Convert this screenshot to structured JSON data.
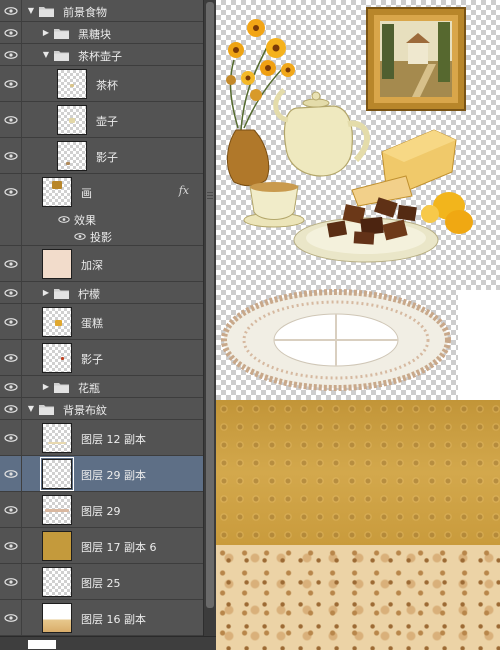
{
  "layers_panel": {
    "groups": {
      "foreground_food": "前景食物",
      "black_sugar": "黑糖块",
      "teapot_set": "茶杯壶子",
      "lemon": "柠檬",
      "vase": "花瓶",
      "background_fabric": "背景布紋"
    },
    "layers": {
      "teacup": "茶杯",
      "teapot": "壶子",
      "shadow_1": "影子",
      "painting": "画",
      "effects": "效果",
      "drop_shadow": "投影",
      "deepen": "加深",
      "cake": "蛋糕",
      "shadow_2": "影子",
      "layer_12_copy": "图层 12 副本",
      "layer_29_copy": "图层 29 副本",
      "layer_29": "图层 29",
      "layer_17_copy_6": "图层 17 副本 6",
      "layer_25": "图层 25",
      "layer_16_copy": "图层 16 副本"
    },
    "fx_badge": "fx",
    "selected_layer": "图层 29 副本"
  },
  "colors": {
    "panel_bg": "#535353",
    "selection": "#5e6f86",
    "wallpaper": "#c59a3a",
    "floor": "#ecd3a6"
  }
}
